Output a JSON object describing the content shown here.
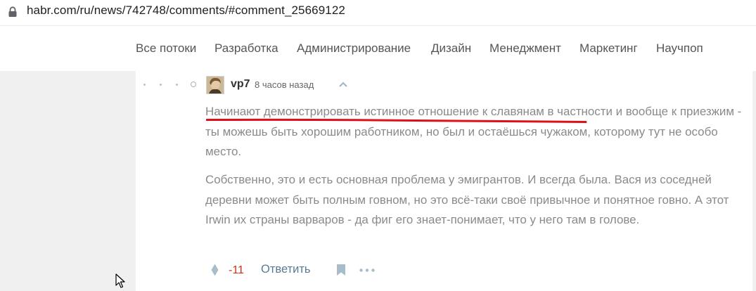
{
  "browser": {
    "url": "habr.com/ru/news/742748/comments/#comment_25669122"
  },
  "nav": {
    "items": [
      {
        "label": "Все потоки"
      },
      {
        "label": "Разработка"
      },
      {
        "label": "Администрирование"
      },
      {
        "label": "Дизайн"
      },
      {
        "label": "Менеджмент"
      },
      {
        "label": "Маркетинг"
      },
      {
        "label": "Научпоп"
      }
    ]
  },
  "comment": {
    "username": "vp7",
    "timestamp": "8 часов назад",
    "paragraph1_highlight": "Начинают демонстрировать истинное отношение к славянам",
    "paragraph1_rest": " в частности и вообще к приезжим - ты можешь быть хорошим работником, но был и остаёшься чужаком, которому тут не особо место.",
    "paragraph2": "Собственно, это и есть основная проблема у эмигрантов. И всегда была. Вася из соседней деревни может быть полным говном, но это всё-таки своё привычное и понятное говно. А этот Irwin их страны варваров - да фиг его знает-понимает, что у него там в голове.",
    "score": "-11",
    "reply_label": "Ответить"
  },
  "colors": {
    "score": "#d0311d",
    "link": "#587b95",
    "text": "#8a8a8a",
    "underline_annotation": "#e0101a",
    "gutter": "#f0f0f0"
  },
  "icons": {
    "lock": "lock-icon",
    "chevron": "chevron-up-icon",
    "vote": "vote-diamond-icon",
    "bookmark": "bookmark-icon",
    "more": "more-dots-icon",
    "cursor": "mouse-cursor-icon"
  }
}
